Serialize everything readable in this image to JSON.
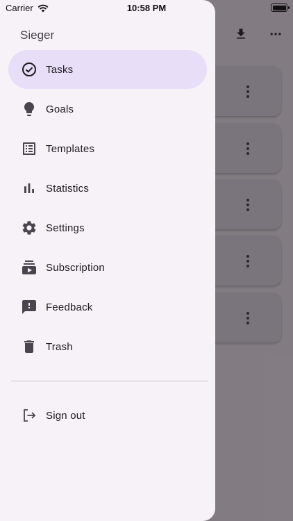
{
  "status_bar": {
    "carrier": "Carrier",
    "time": "10:58 PM"
  },
  "drawer": {
    "title": "Sieger",
    "items": [
      {
        "label": "Tasks",
        "icon": "check-circle-icon",
        "active": true
      },
      {
        "label": "Goals",
        "icon": "lightbulb-icon",
        "active": false
      },
      {
        "label": "Templates",
        "icon": "list-alt-icon",
        "active": false
      },
      {
        "label": "Statistics",
        "icon": "bar-chart-icon",
        "active": false
      },
      {
        "label": "Settings",
        "icon": "gear-icon",
        "active": false
      },
      {
        "label": "Subscription",
        "icon": "subscriptions-icon",
        "active": false
      },
      {
        "label": "Feedback",
        "icon": "feedback-icon",
        "active": false
      },
      {
        "label": "Trash",
        "icon": "trash-icon",
        "active": false
      }
    ],
    "sign_out_label": "Sign out"
  },
  "background": {
    "action_icons": [
      "download-icon",
      "more-horizontal-icon"
    ],
    "task_card_count": 5
  },
  "colors": {
    "drawer_bg": "#f7f1f8",
    "active_item_bg": "#e8def8",
    "icon_color": "#49454f",
    "text_color": "#1d1b20"
  }
}
